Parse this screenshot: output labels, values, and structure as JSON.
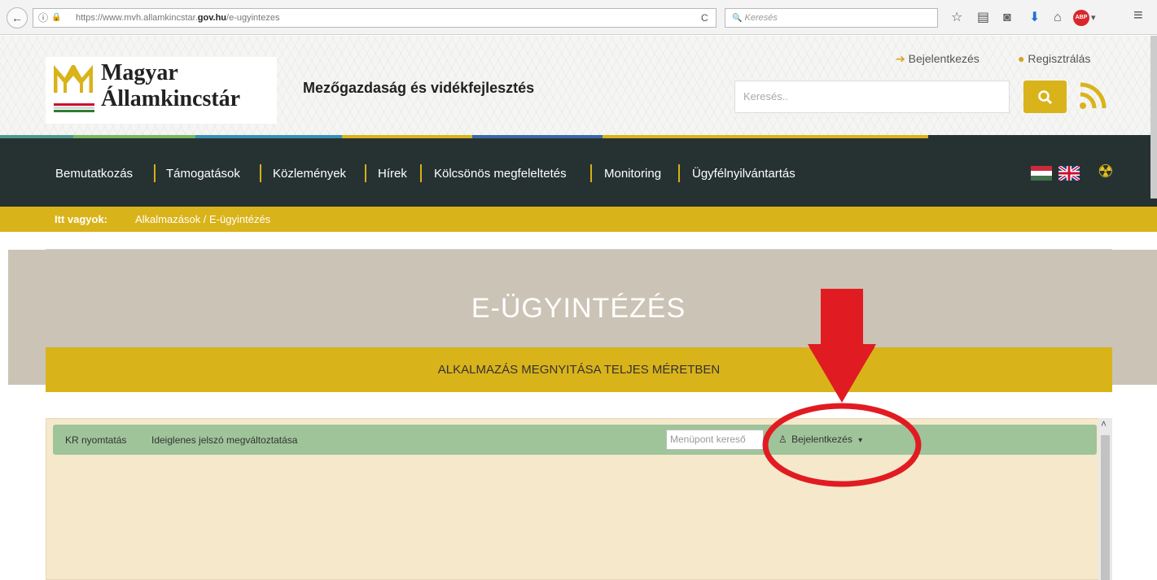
{
  "browser": {
    "url_prefix": "https://www.mvh.allamkincstar.",
    "url_domain": "gov.hu",
    "url_path": "/e-ugyintezes",
    "search_placeholder": "Keresés",
    "back_glyph": "←",
    "info_glyph": "ⓘ",
    "lock_glyph": "🔒",
    "reload_glyph": "C",
    "search_glyph": "🔍",
    "icons": [
      "star-icon",
      "reading-list-icon",
      "pocket-icon",
      "download-icon",
      "home-icon",
      "adblock-icon",
      "menu-icon"
    ],
    "star_glyph": "☆",
    "reading_glyph": "▤",
    "pocket_glyph": "◙",
    "download_glyph": "⬇",
    "home_glyph": "⌂",
    "abp_label": "ABP",
    "dropdown_glyph": "▾",
    "menu_glyph": "≡"
  },
  "header": {
    "logo_line1": "Magyar",
    "logo_line2": "Államkincstár",
    "section_title": "Mezőgazdaság és vidékfejlesztés",
    "login_link": "Bejelentkezés",
    "register_link": "Regisztrálás",
    "search_placeholder": "Keresés..",
    "search_button_glyph": "🔍",
    "rss_glyph": "◝"
  },
  "nav": {
    "items": [
      "Bemutatkozás",
      "Támogatások",
      "Közlemények",
      "Hírek",
      "Kölcsönös megfeleltetés",
      "Monitoring",
      "Ügyfélnyilvántartás"
    ],
    "accessibility_glyph": "☢"
  },
  "breadcrumb": {
    "label": "Itt vagyok:",
    "path": "Alkalmazások / E-ügyintézés"
  },
  "page": {
    "title": "E-ÜGYINTÉZÉS",
    "banner_text": "ALKALMAZÁS MEGNYITÁSA TELJES MÉRETBEN"
  },
  "app": {
    "menu_items": [
      "KR nyomtatás",
      "Ideiglenes jelszó megváltoztatása"
    ],
    "menu_search_placeholder": "Menüpont kereső",
    "login_menu": "Bejelentkezés",
    "user_glyph": "♙",
    "caret_glyph": "▾",
    "scroll_up_glyph": "˄"
  },
  "colors": {
    "accent_gold": "#d9b31a",
    "nav_bg": "#263232",
    "app_toolbar": "#9fc49a",
    "annotation_red": "#e11b22"
  }
}
